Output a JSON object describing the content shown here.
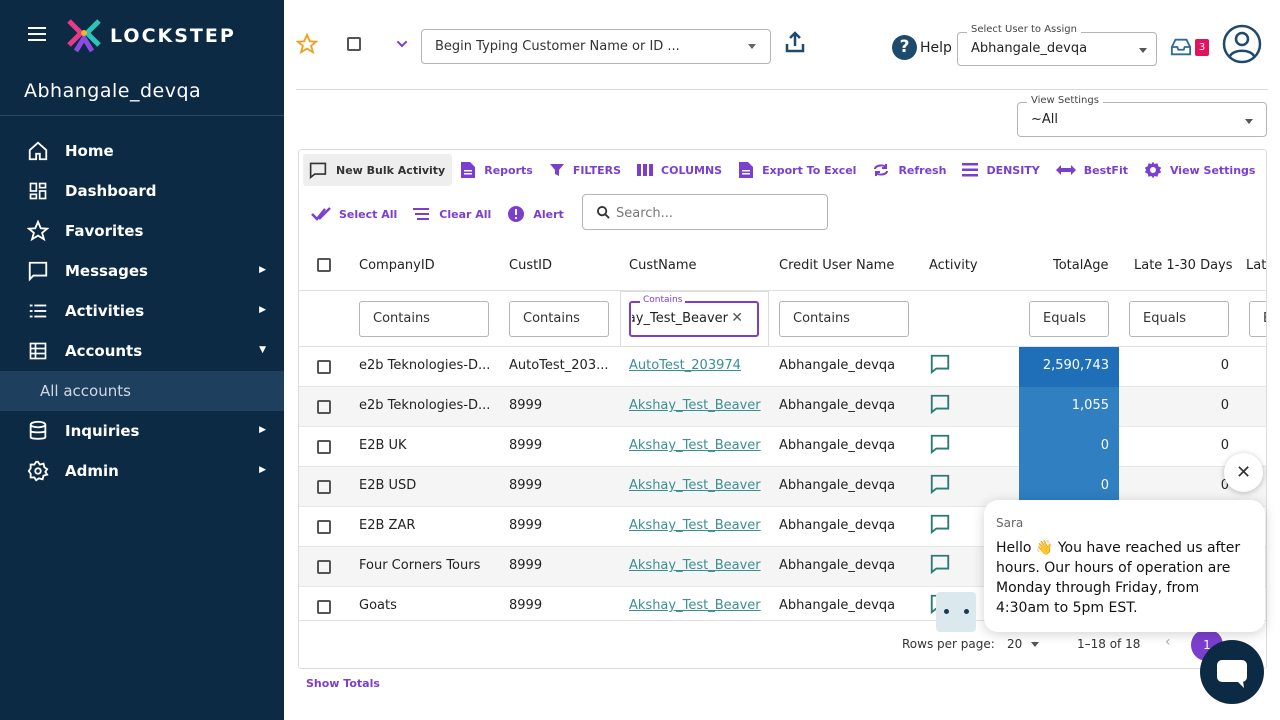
{
  "app": {
    "logo_text": "LOCKSTEP",
    "user": "Abhangale_devqa"
  },
  "sidebar": {
    "items": [
      {
        "label": "Home",
        "icon": "home-icon"
      },
      {
        "label": "Dashboard",
        "icon": "dashboard-icon"
      },
      {
        "label": "Favorites",
        "icon": "star-icon"
      },
      {
        "label": "Messages",
        "icon": "message-icon",
        "arrow": "▶"
      },
      {
        "label": "Activities",
        "icon": "list-icon",
        "arrow": "▶"
      },
      {
        "label": "Accounts",
        "icon": "accounts-icon",
        "arrow": "▼"
      },
      {
        "label": "Inquiries",
        "icon": "database-icon",
        "arrow": "▶"
      },
      {
        "label": "Admin",
        "icon": "gear-icon",
        "arrow": "▶"
      }
    ],
    "sub_item": "All accounts"
  },
  "topbar": {
    "customer_placeholder": "Begin Typing Customer Name or ID ...",
    "help_label": "Help",
    "assign_legend": "Select User to Assign",
    "assign_value": "Abhangale_devqa",
    "inbox_count": "3"
  },
  "view_settings": {
    "legend": "View Settings",
    "value": "~All"
  },
  "toolbar": {
    "new_bulk": "New Bulk Activity",
    "reports": "Reports",
    "filters": "FILTERS",
    "columns": "COLUMNS",
    "export": "Export To Excel",
    "refresh": "Refresh",
    "density": "DENSITY",
    "bestfit": "BestFit",
    "view_settings": "View Settings",
    "select_all": "Select All",
    "clear_all": "Clear All",
    "alert": "Alert",
    "search_placeholder": "Search..."
  },
  "table": {
    "columns": [
      "CompanyID",
      "CustID",
      "CustName",
      "Credit User Name",
      "Activity",
      "TotalAge",
      "Late 1-30 Days",
      "Lat"
    ],
    "filters": [
      "Contains",
      "Contains",
      "Contains",
      "Contains",
      "Equals",
      "Equals",
      "E"
    ],
    "active_filter_legend": "Contains",
    "active_filter_value": "Akshay_Test_Beaver",
    "rows": [
      {
        "company": "e2b Teknologies-D...",
        "cust_id": "AutoTest_203...",
        "cust_name": "AutoTest_203974",
        "credit_user": "Abhangale_devqa",
        "total_age": "2,590,743",
        "late": "0"
      },
      {
        "company": "e2b Teknologies-D...",
        "cust_id": "8999",
        "cust_name": "Akshay_Test_Beaver",
        "credit_user": "Abhangale_devqa",
        "total_age": "1,055",
        "late": "0"
      },
      {
        "company": "E2B UK",
        "cust_id": "8999",
        "cust_name": "Akshay_Test_Beaver",
        "credit_user": "Abhangale_devqa",
        "total_age": "0",
        "late": "0"
      },
      {
        "company": "E2B USD",
        "cust_id": "8999",
        "cust_name": "Akshay_Test_Beaver",
        "credit_user": "Abhangale_devqa",
        "total_age": "0",
        "late": "0"
      },
      {
        "company": "E2B ZAR",
        "cust_id": "8999",
        "cust_name": "Akshay_Test_Beaver",
        "credit_user": "Abhangale_devqa",
        "total_age": "",
        "late": ""
      },
      {
        "company": "Four Corners Tours",
        "cust_id": "8999",
        "cust_name": "Akshay_Test_Beaver",
        "credit_user": "Abhangale_devqa",
        "total_age": "",
        "late": ""
      },
      {
        "company": "Goats",
        "cust_id": "8999",
        "cust_name": "Akshay_Test_Beaver",
        "credit_user": "Abhangale_devqa",
        "total_age": "",
        "late": ""
      }
    ],
    "rows_per_page_label": "Rows per page:",
    "rows_per_page_value": "20",
    "range": "1–18 of 18",
    "page": "1"
  },
  "show_totals": "Show Totals",
  "chat": {
    "agent": "Sara",
    "message": "Hello 👋 You have reached us after hours. Our hours of operation are Monday through Friday, from 4:30am to 5pm EST."
  },
  "colors": {
    "sidebar": "#0d2a45",
    "accent": "#7b3fcf",
    "link": "#3a8f92",
    "age_cell": "#2f7fc1",
    "badge": "#e1135f"
  }
}
